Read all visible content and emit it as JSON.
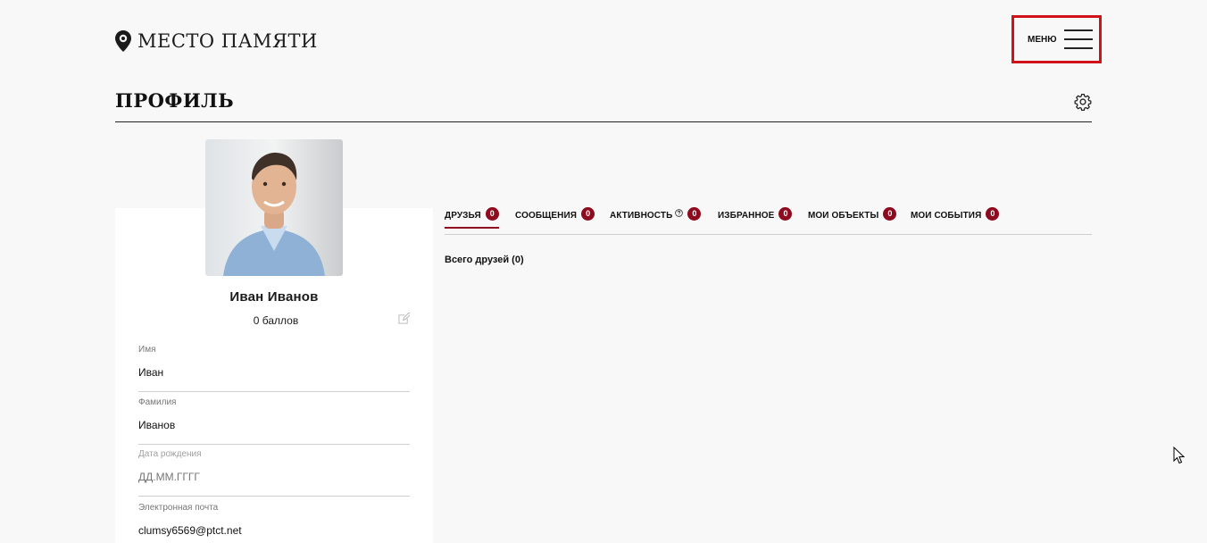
{
  "header": {
    "logo_text": "МЕСТО ПАМЯТИ",
    "logo_icon": "map-pin-icon",
    "menu_label": "МЕНЮ",
    "menu_icon": "hamburger-icon",
    "accent_color": "#d0121b"
  },
  "page": {
    "title": "ПРОФИЛЬ",
    "settings_icon": "gear-icon"
  },
  "profile": {
    "avatar_icon": "avatar-photo",
    "name": "Иван Иванов",
    "points": "0 баллов",
    "edit_icon": "edit-icon",
    "fields": [
      {
        "label": "Имя",
        "value": "Иван",
        "placeholder": ""
      },
      {
        "label": "Фамилия",
        "value": "Иванов",
        "placeholder": ""
      },
      {
        "label": "Дата рождения",
        "value": "",
        "placeholder": "ДД.ММ.ГГГГ"
      },
      {
        "label": "Электронная почта",
        "value": "clumsy6569@ptct.net",
        "placeholder": ""
      }
    ]
  },
  "tabs": [
    {
      "label": "ДРУЗЬЯ",
      "count": "0",
      "active": true
    },
    {
      "label": "СООБЩЕНИЯ",
      "count": "0",
      "active": false
    },
    {
      "label": "АКТИВНОСТЬ",
      "count": "0",
      "active": false,
      "has_help": true
    },
    {
      "label": "ИЗБРАННОЕ",
      "count": "0",
      "active": false
    },
    {
      "label": "МОИ ОБЪЕКТЫ",
      "count": "0",
      "active": false
    },
    {
      "label": "МОИ СОБЫТИЯ",
      "count": "0",
      "active": false
    }
  ],
  "friends": {
    "total_text": "Всего друзей (0)"
  },
  "colors": {
    "badge": "#8e0a1e",
    "background": "#f8f8f8"
  }
}
